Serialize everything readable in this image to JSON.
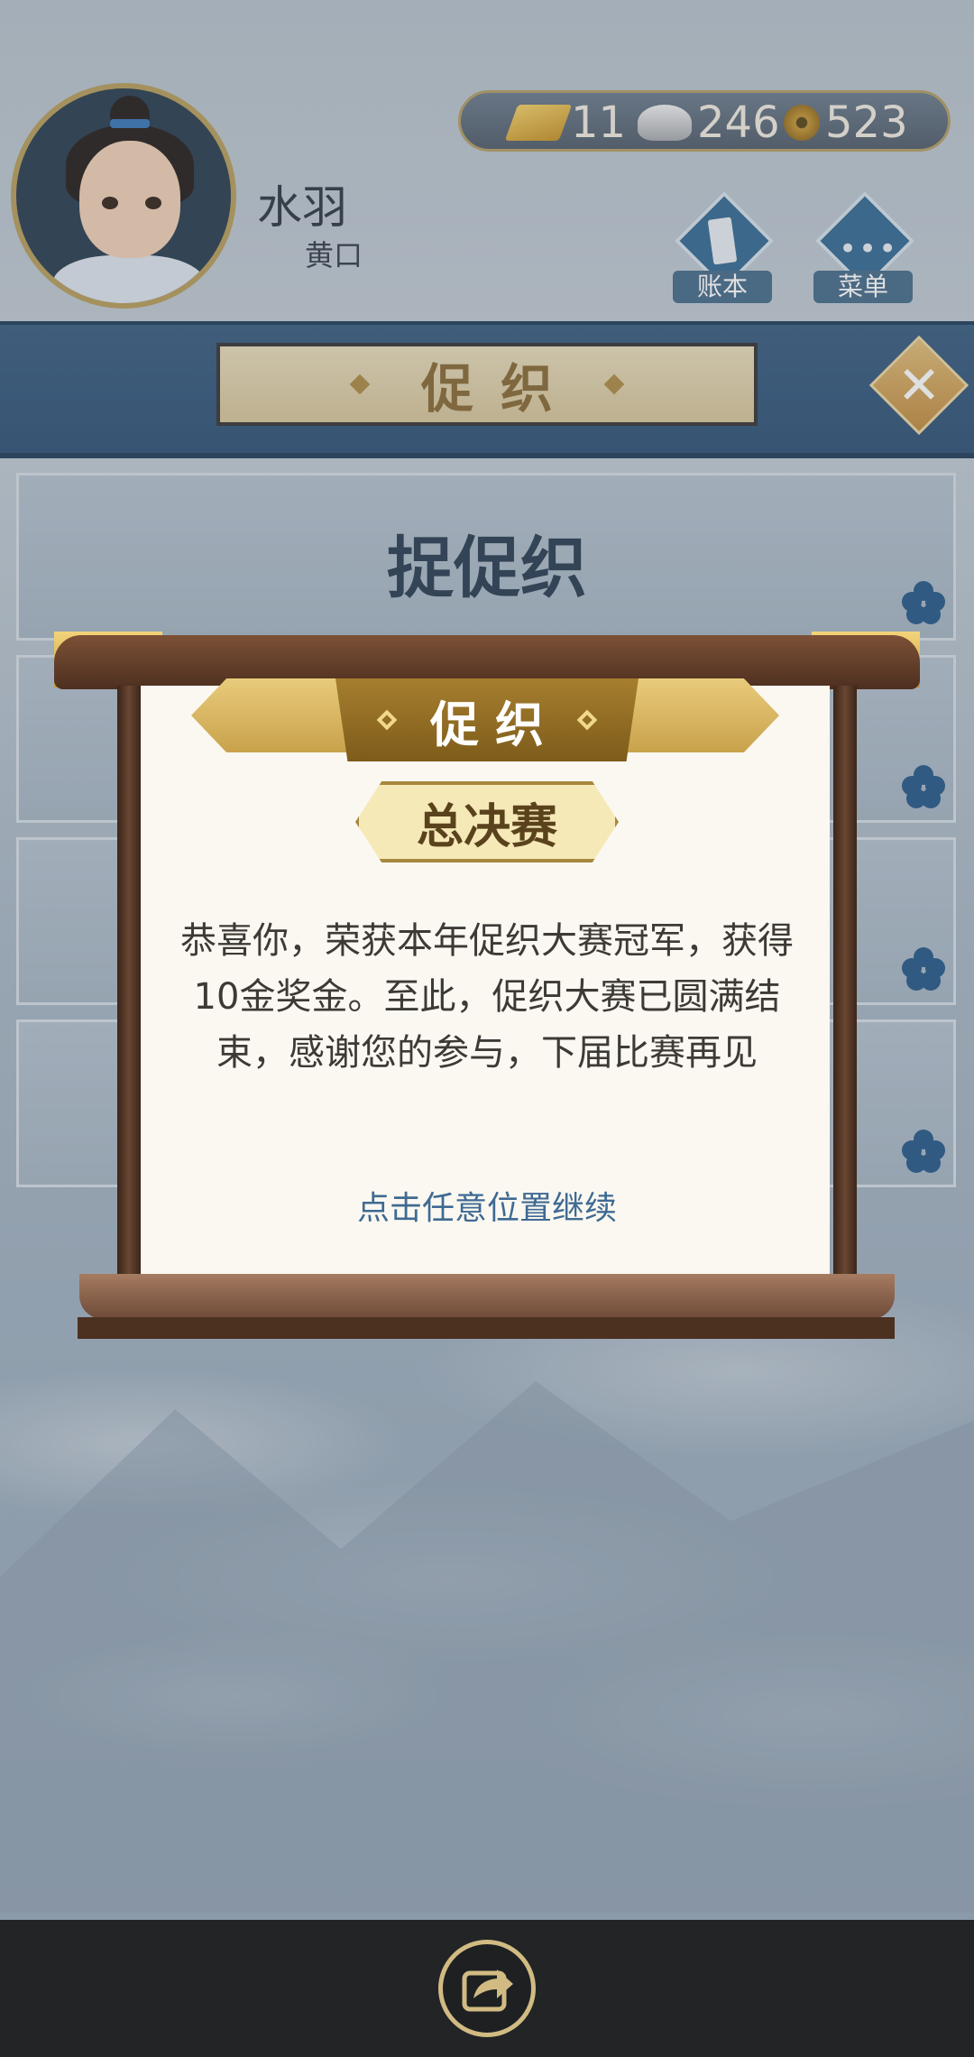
{
  "player": {
    "name": "水羽",
    "rank": "黄口"
  },
  "currency": {
    "gold": "11",
    "silver": "246",
    "copper": "523"
  },
  "header_buttons": {
    "ledger": "账本",
    "menu": "菜单"
  },
  "banner": {
    "title": "促织"
  },
  "list": {
    "title": "捉促织"
  },
  "modal": {
    "title": "促织",
    "stage": "总决赛",
    "message": "恭喜你，荣获本年促织大赛冠军，获得10金奖金。至此，促织大赛已圆满结束，感谢您的参与，下届比赛再见",
    "hint": "点击任意位置继续"
  },
  "icons": {
    "gold": "gold-ingot-icon",
    "silver": "silver-ingot-icon",
    "copper": "copper-coin-icon",
    "close": "close-icon",
    "share": "share-icon"
  },
  "colors": {
    "accent_gold": "#c9a24b",
    "banner_blue": "#3e6283",
    "hint_blue": "#3f6a93"
  }
}
